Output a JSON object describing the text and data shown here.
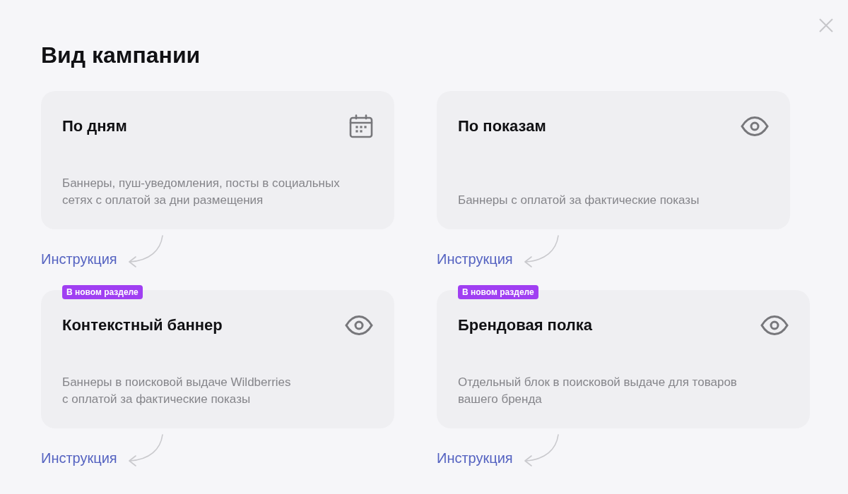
{
  "dialog": {
    "title": "Вид кампании"
  },
  "campaign_types": [
    {
      "kind": "period",
      "title": "По дням",
      "description_lines": [
        "Баннеры, пуш-уведомления, посты в социальных",
        "сетях с оплатой за дни размещения"
      ],
      "link": "Инструкция"
    },
    {
      "kind": "impressions",
      "title": "По показам",
      "description_lines": [
        "Баннеры с оплатой за фактические показы"
      ],
      "link": "Инструкция"
    },
    {
      "kind": "impressions",
      "badge": "В новом разделе",
      "title": "Контекстный баннер",
      "description_lines": [
        "Баннеры в поисковой выдаче Wildberries",
        "с оплатой за фактические показы"
      ],
      "link": "Инструкция"
    },
    {
      "kind": "impressions",
      "badge": "В новом разделе",
      "title": "Брендовая полка",
      "description_lines": [
        "Отдельный блок в поисковой выдаче для товаров",
        "вашего бренда"
      ],
      "link": "Инструкция"
    }
  ]
}
